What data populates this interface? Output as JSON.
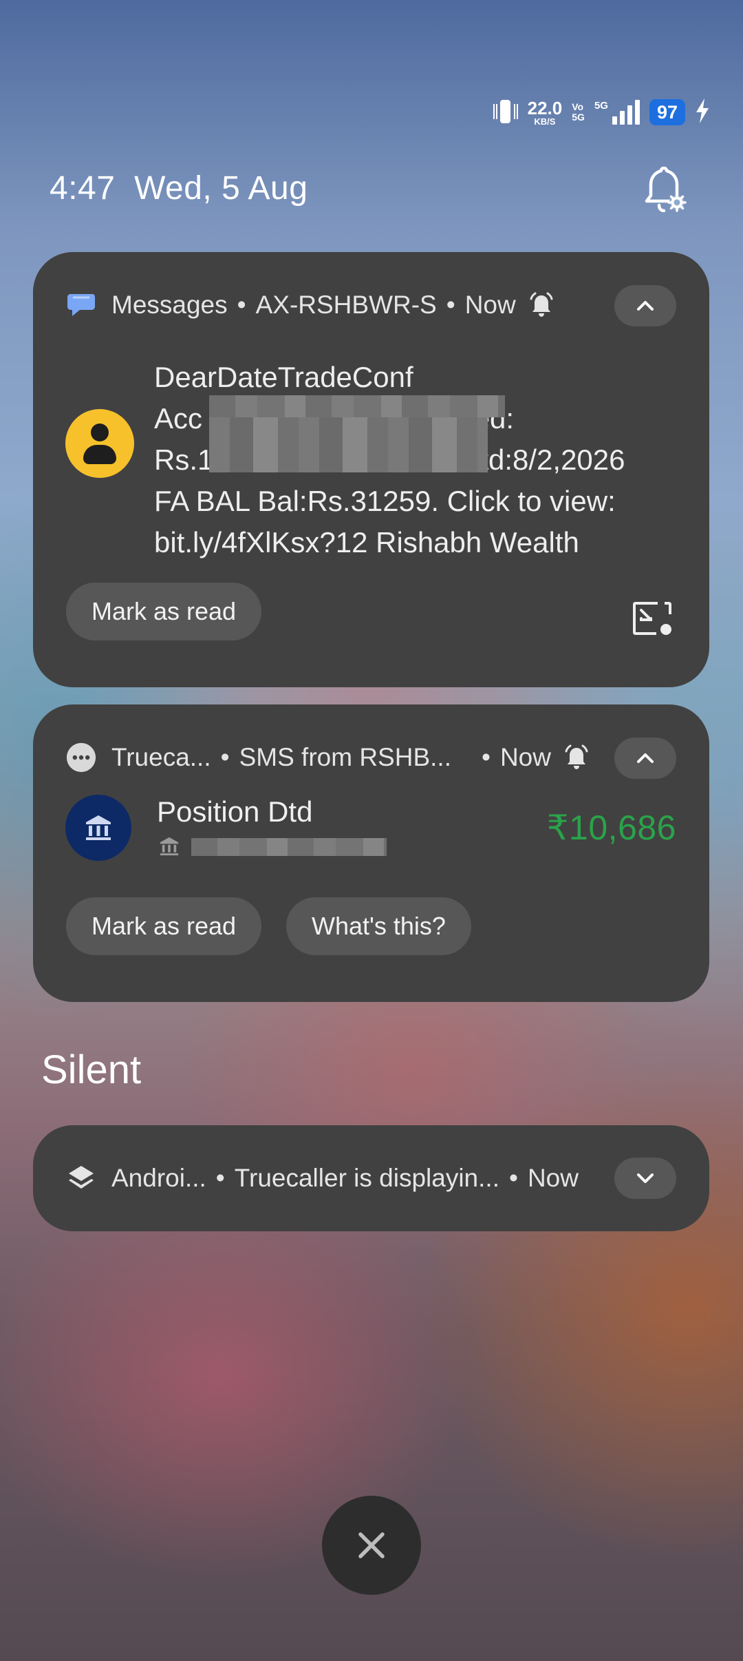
{
  "status_bar": {
    "speed_value": "22.0",
    "speed_unit": "KB/S",
    "vo_top": "Vo",
    "vo_bottom": "5G",
    "network": "5G",
    "battery": "97",
    "vibrate_icon": "vibrate-icon",
    "charging_icon": "charging-bolt-icon"
  },
  "header": {
    "time": "4:47",
    "date": "Wed, 5 Aug",
    "settings_icon": "notification-settings-icon"
  },
  "notifications": [
    {
      "app": "Messages",
      "sender": "AX-RSHBWR-S",
      "time": "Now",
      "icon": "messages-bubble-icon",
      "lines": [
        "DearDateTradeConf",
        "Acc",
        "ceived:",
        "Rs.1",
        "-Dtd:8/2,2026",
        "FA BAL Bal:Rs.31259. Click to view:",
        "bit.ly/4fXlKsx?12 Rishabh Wealth"
      ],
      "actions": [
        "Mark as read"
      ],
      "accent": "#f6c12b"
    },
    {
      "app": "Trueca...",
      "sender": "SMS from RSHB...",
      "time": "Now",
      "title": "Position Dtd",
      "amount": "₹10,686",
      "actions": [
        "Mark as read",
        "What's this?"
      ],
      "amount_color": "#2aa34a"
    }
  ],
  "silent_section": {
    "title": "Silent",
    "app": "Androi...",
    "text": "Truecaller is displayin...",
    "time": "Now"
  },
  "dismiss_icon": "close-icon"
}
